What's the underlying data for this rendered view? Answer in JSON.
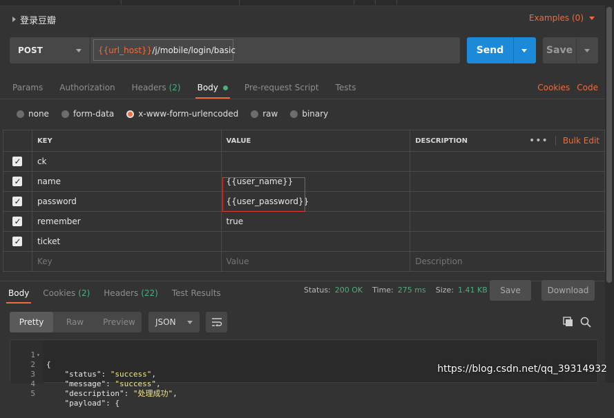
{
  "request": {
    "title": "登录豆瓣",
    "examples_label": "Examples (0)",
    "method": "POST",
    "url_var": "{{url_host}}",
    "url_path": "/j/mobile/login/basic",
    "send_label": "Send",
    "save_label": "Save"
  },
  "tabs": [
    {
      "label": "Params"
    },
    {
      "label": "Authorization"
    },
    {
      "label": "Headers",
      "count": "(2)"
    },
    {
      "label": "Body"
    },
    {
      "label": "Pre-request Script"
    },
    {
      "label": "Tests"
    }
  ],
  "right_links": {
    "cookies": "Cookies",
    "code": "Code"
  },
  "body_types": [
    "none",
    "form-data",
    "x-www-form-urlencoded",
    "raw",
    "binary"
  ],
  "body_type_selected": "x-www-form-urlencoded",
  "table": {
    "headers": {
      "key": "KEY",
      "value": "VALUE",
      "description": "DESCRIPTION"
    },
    "bulk_edit": "Bulk Edit",
    "rows": [
      {
        "key": "ck",
        "value": "",
        "checked": true
      },
      {
        "key": "name",
        "value": "{{user_name}}",
        "checked": true
      },
      {
        "key": "password",
        "value": "{{user_password}}",
        "checked": true
      },
      {
        "key": "remember",
        "value": "true",
        "checked": true
      },
      {
        "key": "ticket",
        "value": "",
        "checked": true
      }
    ],
    "placeholders": {
      "key": "Key",
      "value": "Value",
      "description": "Description"
    }
  },
  "response": {
    "tabs": [
      {
        "label": "Body"
      },
      {
        "label": "Cookies",
        "count": "(2)"
      },
      {
        "label": "Headers",
        "count": "(22)"
      },
      {
        "label": "Test Results"
      }
    ],
    "status_label": "Status:",
    "status_value": "200 OK",
    "time_label": "Time:",
    "time_value": "275 ms",
    "size_label": "Size:",
    "size_value": "1.41 KB",
    "save_label": "Save",
    "download_label": "Download",
    "view_modes": [
      "Pretty",
      "Raw",
      "Preview"
    ],
    "format": "JSON",
    "code_lines": [
      {
        "n": "1",
        "text": "{"
      },
      {
        "n": "2",
        "key": "\"status\"",
        "val": "\"success\""
      },
      {
        "n": "3",
        "key": "\"message\"",
        "val": "\"success\""
      },
      {
        "n": "4",
        "key": "\"description\"",
        "val": "\"处理成功\""
      },
      {
        "n": "5",
        "key": "\"payload\"",
        "val": "{"
      }
    ]
  },
  "watermark": "https://blog.csdn.net/qq_39314932",
  "colors": {
    "accent": "#f26b3a",
    "send": "#1c89d9",
    "success": "#4caf7d",
    "highlight_box": "#e03c31"
  }
}
